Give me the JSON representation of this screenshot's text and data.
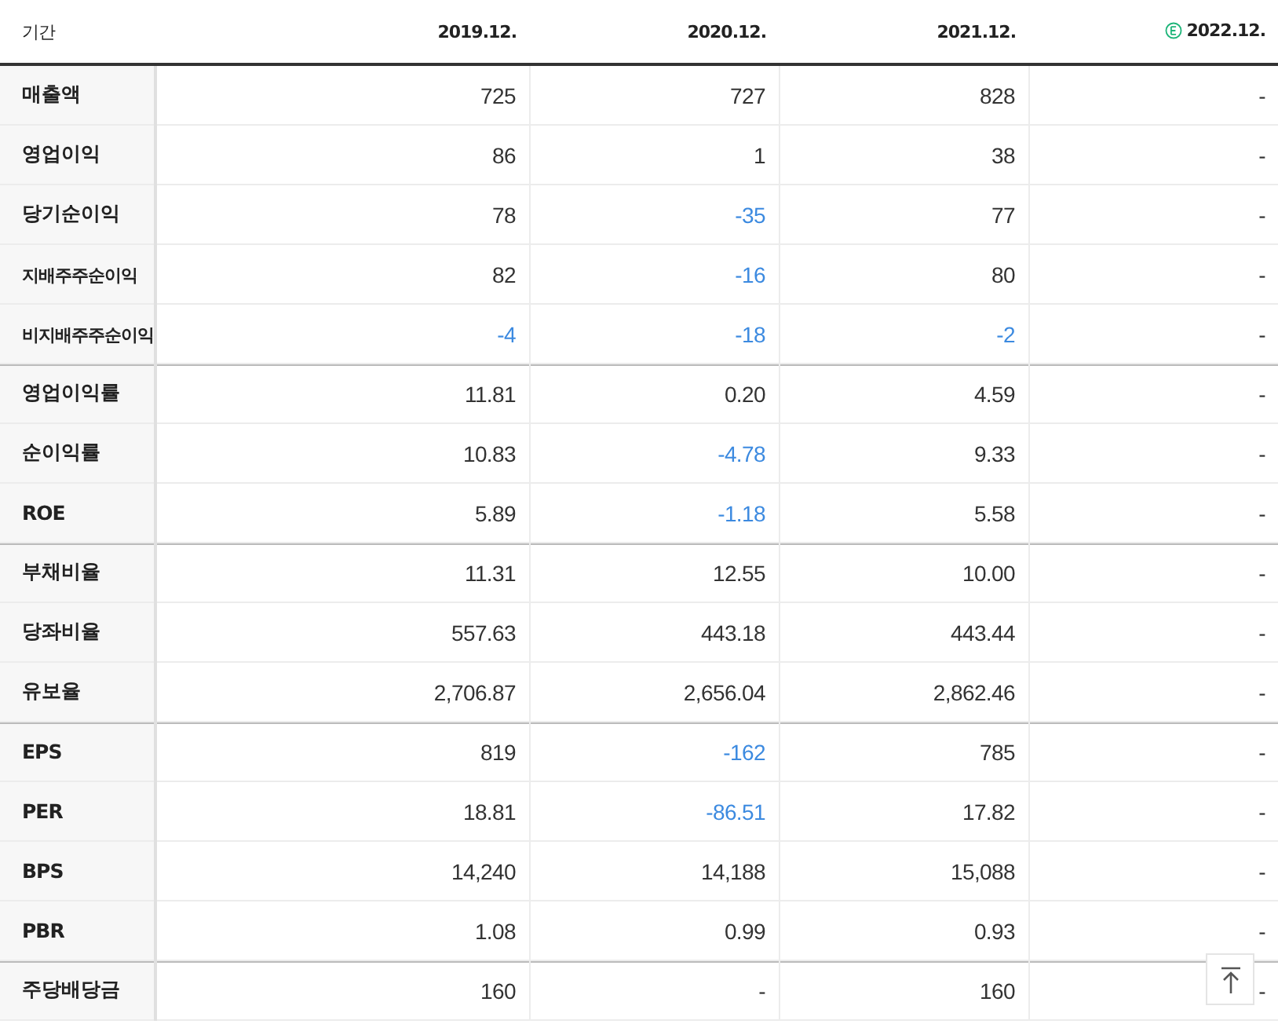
{
  "header": {
    "label": "기간",
    "columns": [
      {
        "text": "2019.12.",
        "estimate": false
      },
      {
        "text": "2020.12.",
        "estimate": false
      },
      {
        "text": "2021.12.",
        "estimate": false
      },
      {
        "text": "2022.12.",
        "estimate": true
      }
    ]
  },
  "rows": [
    {
      "label": "매출액",
      "small": false,
      "group_start": false,
      "cells": [
        {
          "text": "725",
          "negative": false
        },
        {
          "text": "727",
          "negative": false
        },
        {
          "text": "828",
          "negative": false
        },
        {
          "text": "-",
          "negative": false
        }
      ]
    },
    {
      "label": "영업이익",
      "small": false,
      "group_start": false,
      "cells": [
        {
          "text": "86",
          "negative": false
        },
        {
          "text": "1",
          "negative": false
        },
        {
          "text": "38",
          "negative": false
        },
        {
          "text": "-",
          "negative": false
        }
      ]
    },
    {
      "label": "당기순이익",
      "small": false,
      "group_start": false,
      "cells": [
        {
          "text": "78",
          "negative": false
        },
        {
          "text": "-35",
          "negative": true
        },
        {
          "text": "77",
          "negative": false
        },
        {
          "text": "-",
          "negative": false
        }
      ]
    },
    {
      "label": "지배주주순이익",
      "small": true,
      "group_start": false,
      "cells": [
        {
          "text": "82",
          "negative": false
        },
        {
          "text": "-16",
          "negative": true
        },
        {
          "text": "80",
          "negative": false
        },
        {
          "text": "-",
          "negative": false
        }
      ]
    },
    {
      "label": "비지배주주순이익",
      "small": true,
      "group_start": false,
      "cells": [
        {
          "text": "-4",
          "negative": true
        },
        {
          "text": "-18",
          "negative": true
        },
        {
          "text": "-2",
          "negative": true
        },
        {
          "text": "-",
          "negative": false
        }
      ]
    },
    {
      "label": "영업이익률",
      "small": false,
      "group_start": true,
      "cells": [
        {
          "text": "11.81",
          "negative": false
        },
        {
          "text": "0.20",
          "negative": false
        },
        {
          "text": "4.59",
          "negative": false
        },
        {
          "text": "-",
          "negative": false
        }
      ]
    },
    {
      "label": "순이익률",
      "small": false,
      "group_start": false,
      "cells": [
        {
          "text": "10.83",
          "negative": false
        },
        {
          "text": "-4.78",
          "negative": true
        },
        {
          "text": "9.33",
          "negative": false
        },
        {
          "text": "-",
          "negative": false
        }
      ]
    },
    {
      "label": "ROE",
      "small": false,
      "group_start": false,
      "cells": [
        {
          "text": "5.89",
          "negative": false
        },
        {
          "text": "-1.18",
          "negative": true
        },
        {
          "text": "5.58",
          "negative": false
        },
        {
          "text": "-",
          "negative": false
        }
      ]
    },
    {
      "label": "부채비율",
      "small": false,
      "group_start": true,
      "cells": [
        {
          "text": "11.31",
          "negative": false
        },
        {
          "text": "12.55",
          "negative": false
        },
        {
          "text": "10.00",
          "negative": false
        },
        {
          "text": "-",
          "negative": false
        }
      ]
    },
    {
      "label": "당좌비율",
      "small": false,
      "group_start": false,
      "cells": [
        {
          "text": "557.63",
          "negative": false
        },
        {
          "text": "443.18",
          "negative": false
        },
        {
          "text": "443.44",
          "negative": false
        },
        {
          "text": "-",
          "negative": false
        }
      ]
    },
    {
      "label": "유보율",
      "small": false,
      "group_start": false,
      "cells": [
        {
          "text": "2,706.87",
          "negative": false
        },
        {
          "text": "2,656.04",
          "negative": false
        },
        {
          "text": "2,862.46",
          "negative": false
        },
        {
          "text": "-",
          "negative": false
        }
      ]
    },
    {
      "label": "EPS",
      "small": false,
      "group_start": true,
      "cells": [
        {
          "text": "819",
          "negative": false
        },
        {
          "text": "-162",
          "negative": true
        },
        {
          "text": "785",
          "negative": false
        },
        {
          "text": "-",
          "negative": false
        }
      ]
    },
    {
      "label": "PER",
      "small": false,
      "group_start": false,
      "cells": [
        {
          "text": "18.81",
          "negative": false
        },
        {
          "text": "-86.51",
          "negative": true
        },
        {
          "text": "17.82",
          "negative": false
        },
        {
          "text": "-",
          "negative": false
        }
      ]
    },
    {
      "label": "BPS",
      "small": false,
      "group_start": false,
      "cells": [
        {
          "text": "14,240",
          "negative": false
        },
        {
          "text": "14,188",
          "negative": false
        },
        {
          "text": "15,088",
          "negative": false
        },
        {
          "text": "-",
          "negative": false
        }
      ]
    },
    {
      "label": "PBR",
      "small": false,
      "group_start": false,
      "cells": [
        {
          "text": "1.08",
          "negative": false
        },
        {
          "text": "0.99",
          "negative": false
        },
        {
          "text": "0.93",
          "negative": false
        },
        {
          "text": "-",
          "negative": false
        }
      ]
    },
    {
      "label": "주당배당금",
      "small": false,
      "group_start": true,
      "cells": [
        {
          "text": "160",
          "negative": false
        },
        {
          "text": "-",
          "negative": false
        },
        {
          "text": "160",
          "negative": false
        },
        {
          "text": "-",
          "negative": false
        }
      ]
    }
  ]
}
